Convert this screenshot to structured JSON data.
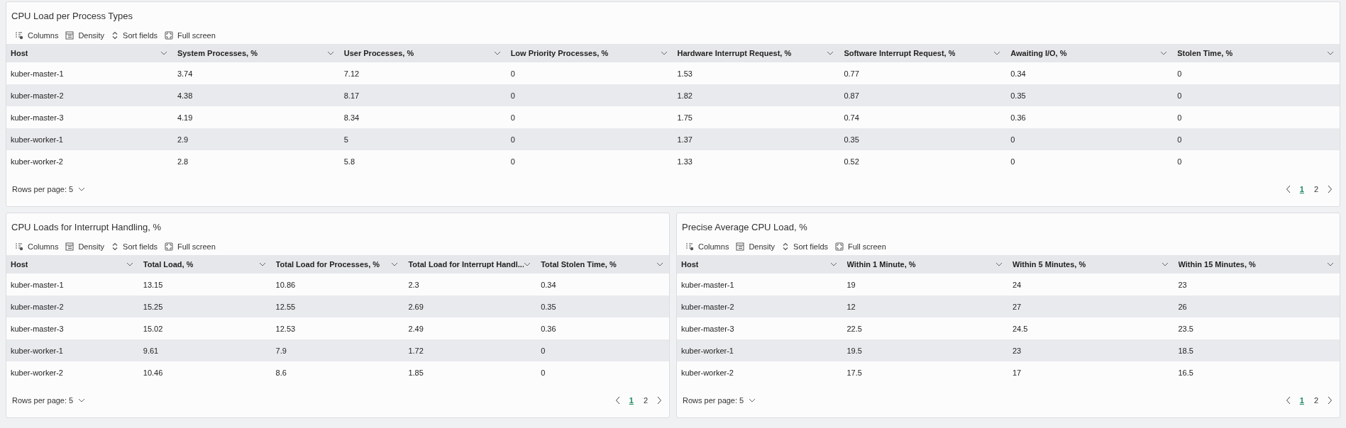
{
  "panels": [
    {
      "title": "CPU Load per Process Types",
      "toolbar": [
        {
          "kind": "columns",
          "label": "Columns"
        },
        {
          "kind": "density",
          "label": "Density"
        },
        {
          "kind": "sort",
          "label": "Sort fields"
        },
        {
          "kind": "fullscreen",
          "label": "Full screen"
        }
      ],
      "columns": [
        "Host",
        "System Processes, %",
        "User Processes, %",
        "Low Priority Processes, %",
        "Hardware Interrupt Request, %",
        "Software Interrupt Request, %",
        "Awaiting I/O, %",
        "Stolen Time, %"
      ],
      "rows": [
        [
          "kuber-master-1",
          "3.74",
          "7.12",
          "0",
          "1.53",
          "0.77",
          "0.34",
          "0"
        ],
        [
          "kuber-master-2",
          "4.38",
          "8.17",
          "0",
          "1.82",
          "0.87",
          "0.35",
          "0"
        ],
        [
          "kuber-master-3",
          "4.19",
          "8.34",
          "0",
          "1.75",
          "0.74",
          "0.36",
          "0"
        ],
        [
          "kuber-worker-1",
          "2.9",
          "5",
          "0",
          "1.37",
          "0.35",
          "0",
          "0"
        ],
        [
          "kuber-worker-2",
          "2.8",
          "5.8",
          "0",
          "1.33",
          "0.52",
          "0",
          "0"
        ]
      ],
      "rows_per_page": "Rows per page: 5",
      "pages": [
        {
          "label": "1",
          "selected": true
        },
        {
          "label": "2",
          "selected": false
        }
      ]
    },
    {
      "title": "CPU Loads for Interrupt Handling, %",
      "toolbar": [
        {
          "kind": "columns",
          "label": "Columns"
        },
        {
          "kind": "density",
          "label": "Density"
        },
        {
          "kind": "sort",
          "label": "Sort fields"
        },
        {
          "kind": "fullscreen",
          "label": "Full screen"
        }
      ],
      "columns": [
        "Host",
        "Total Load, %",
        "Total Load for Processes, %",
        "Total Load for Interrupt Handl...",
        "Total Stolen Time, %"
      ],
      "rows": [
        [
          "kuber-master-1",
          "13.15",
          "10.86",
          "2.3",
          "0.34"
        ],
        [
          "kuber-master-2",
          "15.25",
          "12.55",
          "2.69",
          "0.35"
        ],
        [
          "kuber-master-3",
          "15.02",
          "12.53",
          "2.49",
          "0.36"
        ],
        [
          "kuber-worker-1",
          "9.61",
          "7.9",
          "1.72",
          "0"
        ],
        [
          "kuber-worker-2",
          "10.46",
          "8.6",
          "1.85",
          "0"
        ]
      ],
      "rows_per_page": "Rows per page: 5",
      "pages": [
        {
          "label": "1",
          "selected": true
        },
        {
          "label": "2",
          "selected": false
        }
      ]
    },
    {
      "title": "Precise Average CPU Load, %",
      "toolbar": [
        {
          "kind": "columns",
          "label": "Columns"
        },
        {
          "kind": "density",
          "label": "Density"
        },
        {
          "kind": "sort",
          "label": "Sort fields"
        },
        {
          "kind": "fullscreen",
          "label": "Full screen"
        }
      ],
      "columns": [
        "Host",
        "Within 1 Minute, %",
        "Within 5 Minutes, %",
        "Within 15 Minutes, %"
      ],
      "rows": [
        [
          "kuber-master-1",
          "19",
          "24",
          "23"
        ],
        [
          "kuber-master-2",
          "12",
          "27",
          "26"
        ],
        [
          "kuber-master-3",
          "22.5",
          "24.5",
          "23.5"
        ],
        [
          "kuber-worker-1",
          "19.5",
          "23",
          "18.5"
        ],
        [
          "kuber-worker-2",
          "17.5",
          "17",
          "16.5"
        ]
      ],
      "rows_per_page": "Rows per page: 5",
      "pages": [
        {
          "label": "1",
          "selected": true
        },
        {
          "label": "2",
          "selected": false
        }
      ]
    }
  ]
}
